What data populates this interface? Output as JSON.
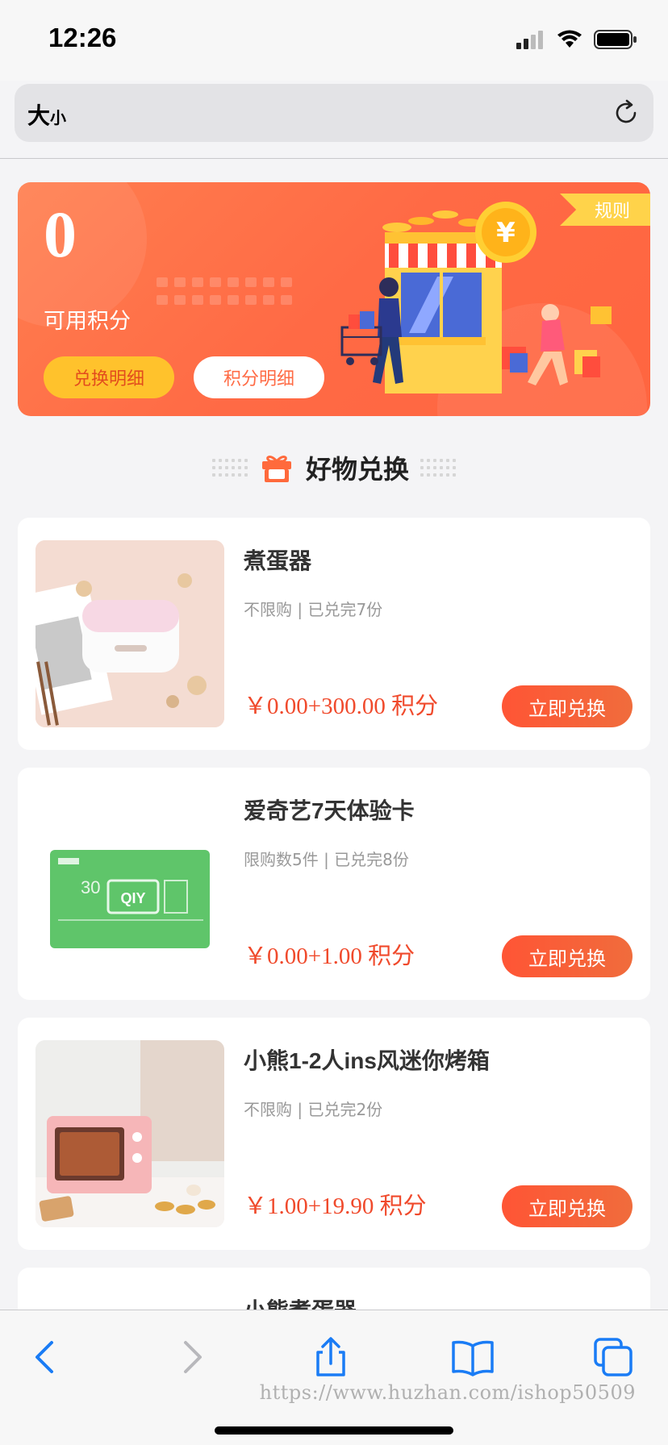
{
  "status_bar": {
    "time": "12:26"
  },
  "address_bar": {
    "text_size_big": "大",
    "text_size_small": "小"
  },
  "banner": {
    "points_value": "0",
    "points_label": "可用积分",
    "exchange_detail_label": "兑换明细",
    "points_detail_label": "积分明细",
    "rules_label": "规则"
  },
  "section": {
    "title": "好物兑换"
  },
  "products": [
    {
      "name": "煮蛋器",
      "meta": "不限购 | 已兑完7份",
      "price": "￥0.00+300.00 积分",
      "button": "立即兑换"
    },
    {
      "name": "爱奇艺7天体验卡",
      "meta": "限购数5件 | 已兑完8份",
      "price": "￥0.00+1.00 积分",
      "button": "立即兑换"
    },
    {
      "name": "小熊1-2人ins风迷你烤箱",
      "meta": "不限购 | 已兑完2份",
      "price": "￥1.00+19.90 积分",
      "button": "立即兑换"
    },
    {
      "name": "小熊煮蛋器"
    }
  ],
  "iqiyi_card": {
    "brand": "QIY",
    "value": "30"
  },
  "watermark": "https://www.huzhan.com/ishop50509",
  "colors": {
    "accent": "#f04a2c",
    "banner": "#ff6a45",
    "pill_yellow": "#ffc22c",
    "ios_blue": "#1a7cf5"
  }
}
